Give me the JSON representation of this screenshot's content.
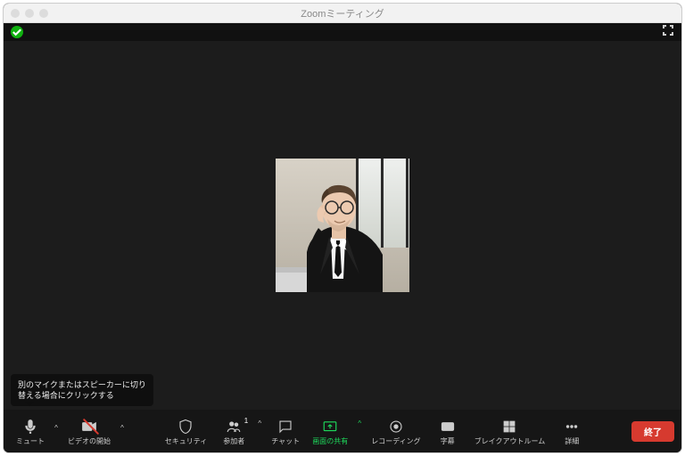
{
  "window": {
    "title": "Zoomミーティング"
  },
  "tooltip": {
    "line1": "別のマイクまたはスピーカーに切り",
    "line2": "替える場合にクリックする"
  },
  "toolbar": {
    "mute": "ミュート",
    "video": "ビデオの開始",
    "security": "セキュリティ",
    "participants": "参加者",
    "participants_count": "1",
    "chat": "チャット",
    "share": "画面の共有",
    "record": "レコーディング",
    "cc": "字幕",
    "breakout": "ブレイクアウトルーム",
    "more": "詳細",
    "end": "終了"
  },
  "colors": {
    "accent_green": "#1edb5c",
    "end_red": "#d63a2f"
  }
}
